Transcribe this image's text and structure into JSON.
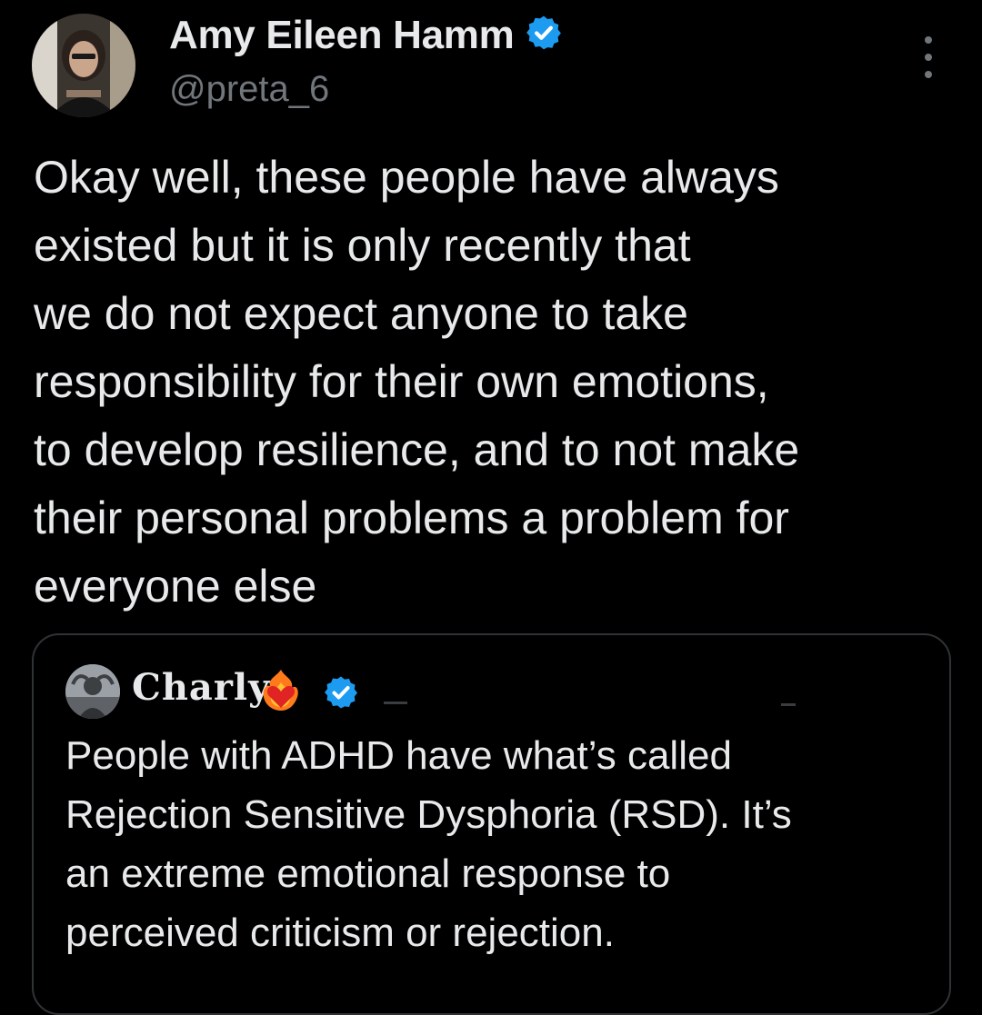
{
  "tweet": {
    "author_name": "Amy Eileen Hamm",
    "author_handle": "@preta_6",
    "verified": true,
    "more_icon": "more-vertical-icon",
    "text_lines": [
      "Okay well, these people have always",
      "existed but it is only recently that",
      "we do not expect anyone to take",
      "responsibility for their own emotions,",
      "to develop resilience, and to not make",
      "their personal problems a problem for",
      "everyone else"
    ]
  },
  "quoted_tweet": {
    "author_name": "Charly",
    "name_emoji": "heart-on-fire-icon",
    "verified": true,
    "text_lines": [
      "People with ADHD have what’s called",
      "Rejection Sensitive Dysphoria (RSD). It’s",
      "an extreme emotional response to",
      "perceived criticism or rejection."
    ]
  },
  "colors": {
    "background": "#000000",
    "text": "#e7e9ea",
    "secondary_text": "#71767b",
    "verified_badge": "#1d9bf0",
    "card_border": "#2f3336"
  }
}
